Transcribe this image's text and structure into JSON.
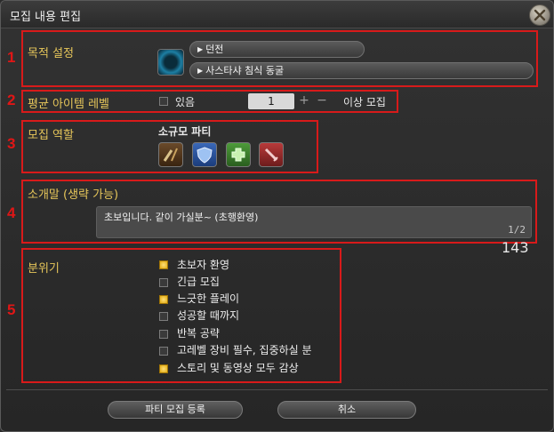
{
  "window": {
    "title": "모집 내용 편집"
  },
  "annotations": [
    "1",
    "2",
    "3",
    "4",
    "5"
  ],
  "purpose": {
    "label": "목적 설정",
    "category": "던전",
    "duty": "사스타샤 침식 동굴"
  },
  "item_level": {
    "label": "평균 아이템 레벨",
    "has_label": "있음",
    "value": "1",
    "plus": "+",
    "minus": "−",
    "suffix": "이상 모집"
  },
  "roles": {
    "label": "모집 역할",
    "party_type": "소규모 파티",
    "icons": [
      "all-role-icon",
      "tank-icon",
      "healer-icon",
      "dps-icon"
    ]
  },
  "comment": {
    "label": "소개말 (생략 가능)",
    "text": "초보입니다. 같이 가실분~ (초행환영)",
    "page": "1/2",
    "char_count": "143"
  },
  "mood": {
    "label": "분위기",
    "options": [
      {
        "label": "초보자 환영",
        "checked": true
      },
      {
        "label": "긴급 모집",
        "checked": false
      },
      {
        "label": "느긋한 플레이",
        "checked": true
      },
      {
        "label": "성공할 때까지",
        "checked": false
      },
      {
        "label": "반복 공략",
        "checked": false
      },
      {
        "label": "고레벨 장비 필수, 집중하실 분",
        "checked": false
      },
      {
        "label": "스토리 및 동영상 모두 감상",
        "checked": true
      }
    ]
  },
  "footer": {
    "submit_label": "파티 모집 등록",
    "cancel_label": "취소"
  },
  "colors": {
    "accent": "#e6c65a",
    "annotation_red": "#d81a1a",
    "checkbox_on": "#f0c020"
  }
}
